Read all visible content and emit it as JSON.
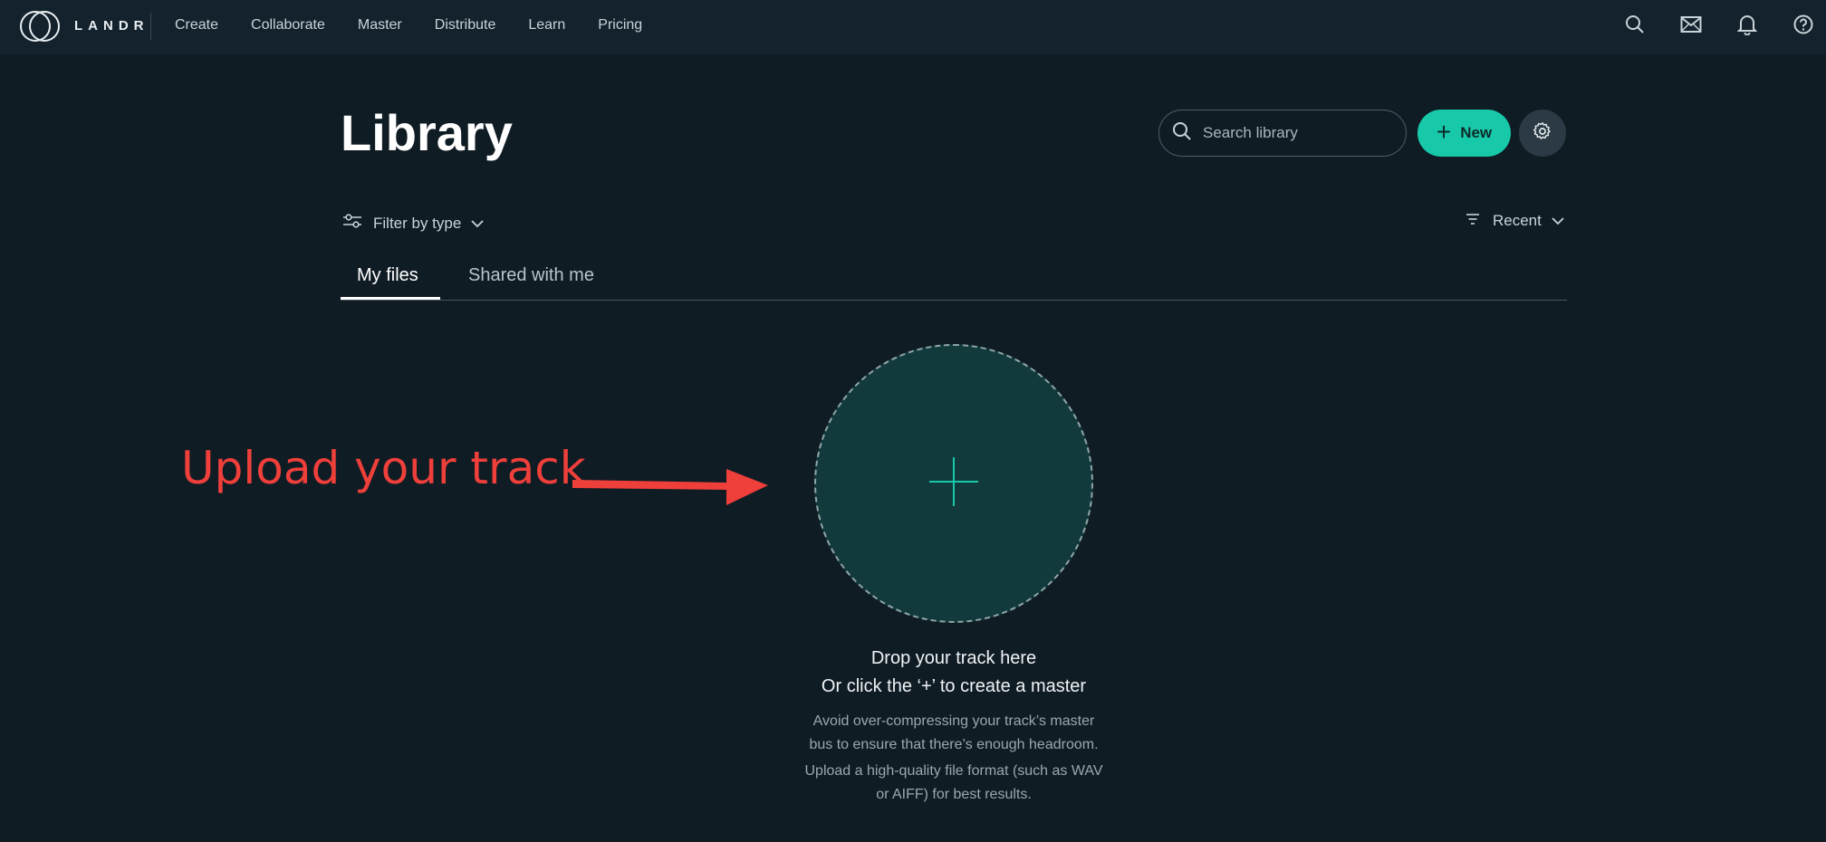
{
  "brand": {
    "name": "LANDR"
  },
  "nav": {
    "items": [
      "Create",
      "Collaborate",
      "Master",
      "Distribute",
      "Learn",
      "Pricing"
    ]
  },
  "top_icons": [
    "search-icon",
    "mail-icon",
    "bell-icon",
    "help-icon"
  ],
  "library": {
    "title": "Library",
    "search_placeholder": "Search library",
    "new_label": "New",
    "filter_label": "Filter by type",
    "sort_label": "Recent",
    "tabs": [
      {
        "label": "My files",
        "active": true
      },
      {
        "label": "Shared with me",
        "active": false
      }
    ]
  },
  "dropzone": {
    "line1": "Drop your track here",
    "line2": "Or click the ‘+’ to create a master",
    "hint1_line1": "Avoid over-compressing your track’s master",
    "hint1_line2": "bus to ensure that there’s enough headroom.",
    "hint2_line1": "Upload a high-quality file format (such as WAV",
    "hint2_line2": "or AIFF) for best results."
  },
  "annotation": {
    "text": "Upload your track",
    "color": "#ef3f3a"
  },
  "colors": {
    "background": "#101c24",
    "topbar": "#13222d",
    "accent": "#17c9a8",
    "dropzone_fill": "#123a3d"
  }
}
